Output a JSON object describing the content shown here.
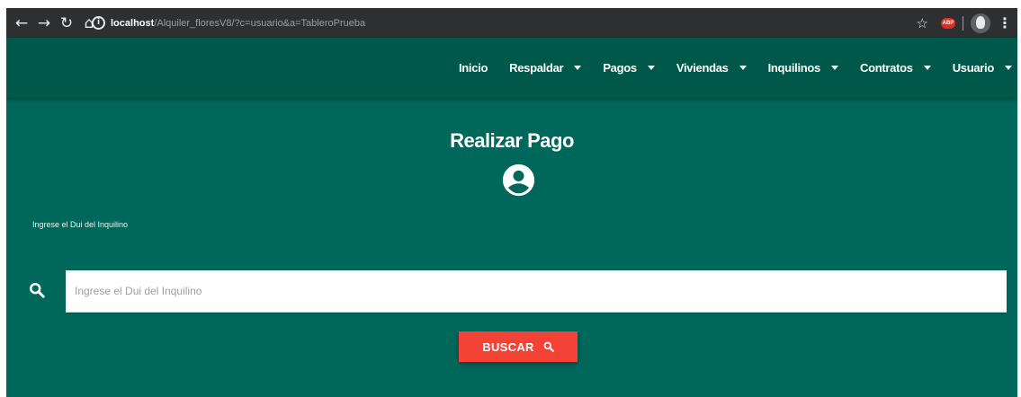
{
  "browser": {
    "url_host": "localhost",
    "url_path": "/Alquiler_floresV8/?c=usuario&a=TableroPrueba",
    "extension_label": "ABP"
  },
  "navbar": {
    "items": [
      {
        "label": "Inicio",
        "dropdown": false
      },
      {
        "label": "Respaldar",
        "dropdown": true
      },
      {
        "label": "Pagos",
        "dropdown": true
      },
      {
        "label": "Viviendas",
        "dropdown": true
      },
      {
        "label": "Inquilinos",
        "dropdown": true
      },
      {
        "label": "Contratos",
        "dropdown": true
      },
      {
        "label": "Usuario",
        "dropdown": true
      }
    ]
  },
  "main": {
    "title": "Realizar Pago",
    "field_label": "Ingrese el Dui del Inquilino",
    "search_placeholder": "Ingrese el Dui del Inquilino",
    "search_button_label": "BUSCAR"
  },
  "colors": {
    "page_bg": "#00675b",
    "navbar_bg": "#00584b",
    "button_bg": "#f44336"
  }
}
